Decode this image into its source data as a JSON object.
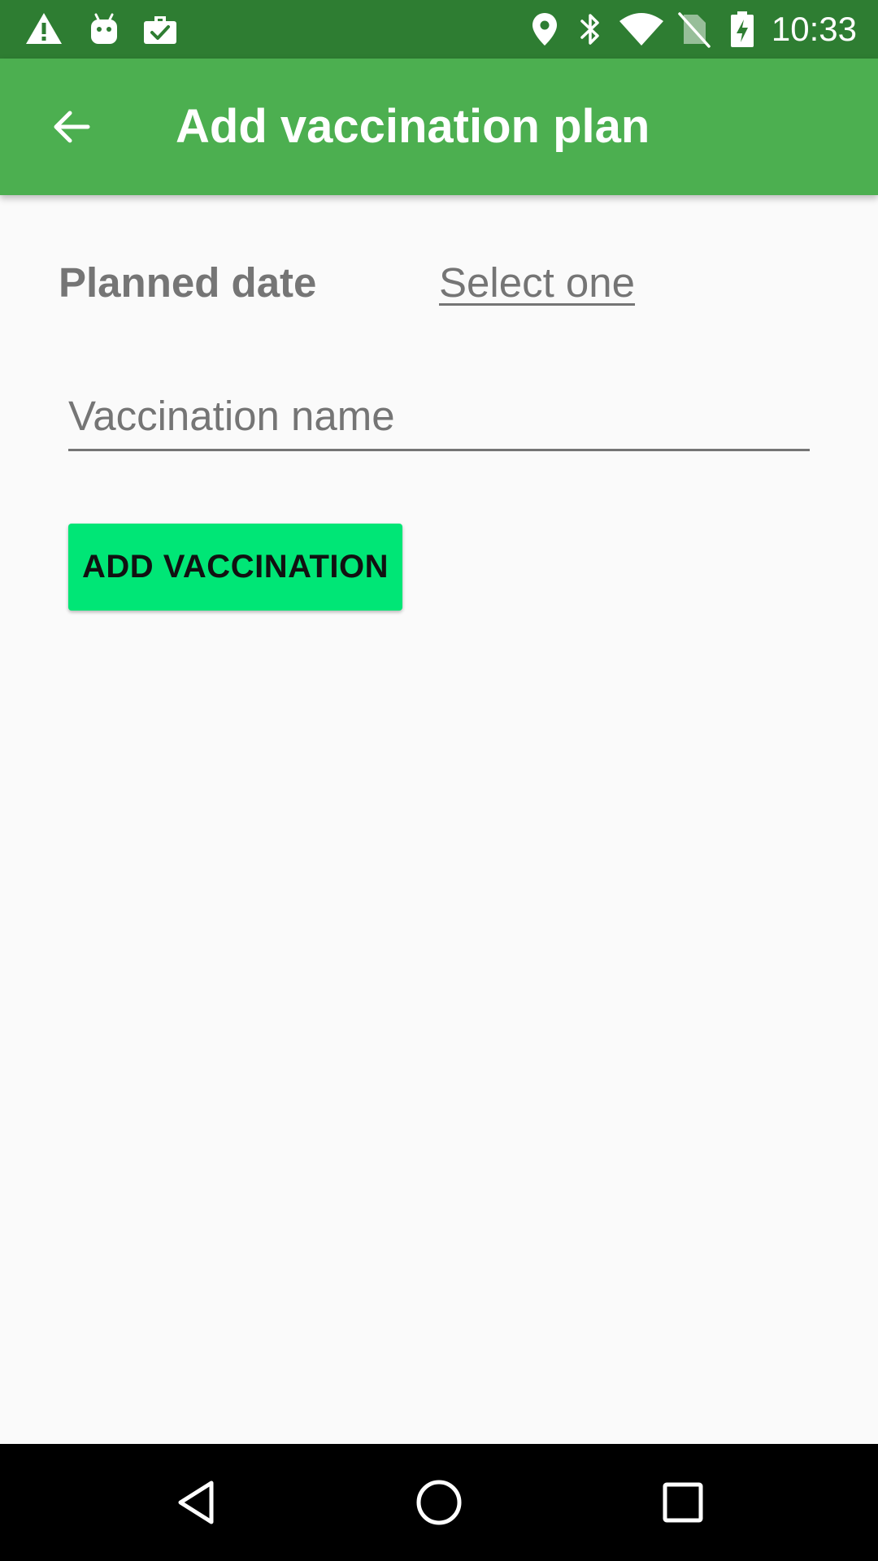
{
  "status_bar": {
    "time": "10:33",
    "left_icons": [
      "warning-icon",
      "android-icon",
      "briefcase-check-icon"
    ],
    "right_icons": [
      "location-icon",
      "bluetooth-icon",
      "wifi-icon",
      "no-sim-icon",
      "battery-charging-icon"
    ]
  },
  "app_bar": {
    "title": "Add vaccination plan",
    "back_icon": "arrow-back-icon",
    "color": "#4caf50",
    "status_color": "#2e7d32"
  },
  "form": {
    "planned_date_label": "Planned date",
    "planned_date_value": "Select one",
    "vaccination_name_placeholder": "Vaccination name",
    "vaccination_name_value": "",
    "add_button_label": "ADD VACCINATION",
    "button_color": "#00e676"
  },
  "nav_bar": {
    "icons": [
      "nav-back-icon",
      "nav-home-icon",
      "nav-recents-icon"
    ]
  }
}
